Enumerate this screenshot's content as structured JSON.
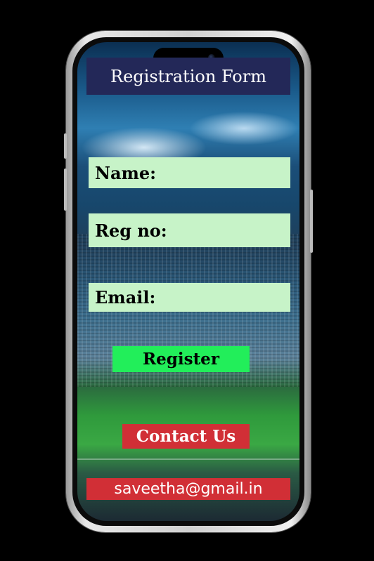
{
  "form": {
    "title": "Registration Form",
    "fields": [
      {
        "label": "Name:"
      },
      {
        "label": "Reg no:"
      },
      {
        "label": "Email:"
      }
    ],
    "register_label": "Register"
  },
  "contact": {
    "button_label": "Contact Us",
    "email": "saveetha@gmail.in"
  },
  "colors": {
    "title_bg": "#232858",
    "field_bg": "#c7f3c8",
    "register_bg": "#22ee5a",
    "contact_bg": "#d12f36"
  }
}
